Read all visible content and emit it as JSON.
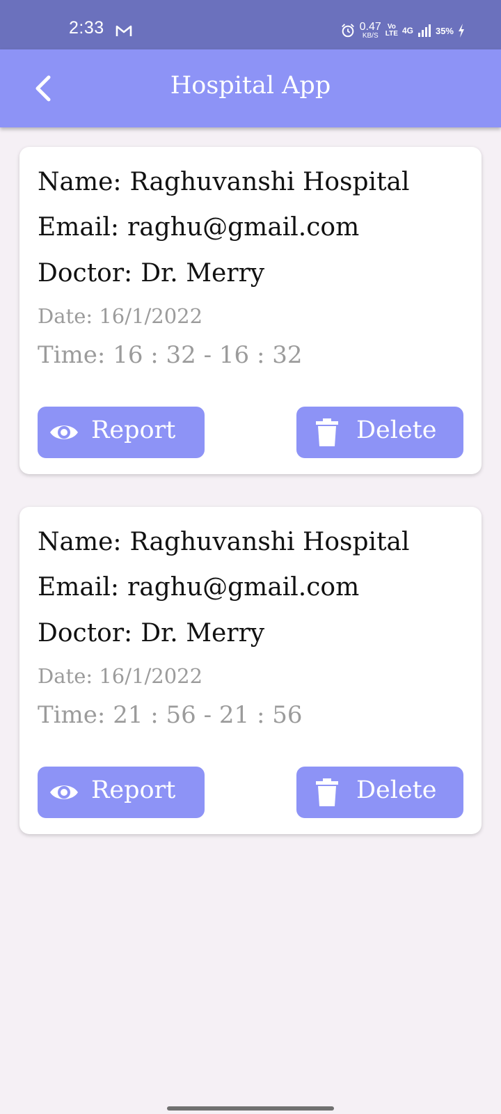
{
  "status_bar": {
    "time": "2:33",
    "speed_value": "0.47",
    "speed_unit": "KB/S",
    "volte_top": "Vo",
    "volte_bottom": "LTE",
    "network": "4G",
    "battery": "35%"
  },
  "app_bar": {
    "title": "Hospital App"
  },
  "appointments": [
    {
      "name_label": "Name:",
      "name": "Raghuvanshi Hospital",
      "email_label": "Email:",
      "email": "raghu@gmail.com",
      "doctor_label": "Doctor:",
      "doctor": "Dr. Merry",
      "date_label": "Date:",
      "date": "16/1/2022",
      "time_label": "Time:",
      "time": "16 : 32 - 16 : 32",
      "report_label": "Report",
      "delete_label": "Delete"
    },
    {
      "name_label": "Name:",
      "name": "Raghuvanshi Hospital",
      "email_label": "Email:",
      "email": "raghu@gmail.com",
      "doctor_label": "Doctor:",
      "doctor": "Dr. Merry",
      "date_label": "Date:",
      "date": "16/1/2022",
      "time_label": "Time:",
      "time": "21 : 56 - 21 : 56",
      "report_label": "Report",
      "delete_label": "Delete"
    }
  ],
  "icons": {
    "back": "chevron-left-icon",
    "report": "eye-icon",
    "delete": "trash-icon",
    "mail": "gmail-icon",
    "alarm": "alarm-icon",
    "signal": "signal-icon",
    "charging": "bolt-icon"
  },
  "colors": {
    "status_bar": "#6b71bd",
    "accent": "#8d93f6",
    "background": "#f5f0f5",
    "card": "#ffffff",
    "muted_text": "#9b9b9b"
  }
}
